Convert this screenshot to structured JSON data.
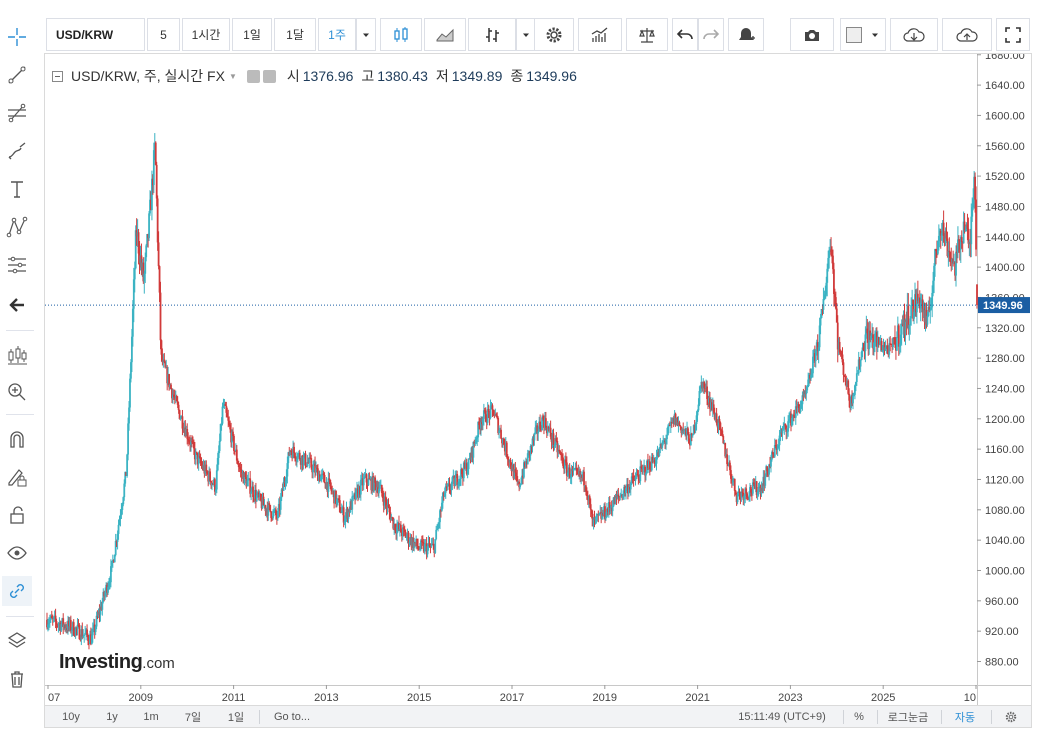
{
  "toolbar": {
    "symbol": "USD/KRW",
    "intervals": [
      "5",
      "1시간",
      "1일",
      "1달",
      "1주"
    ],
    "active_interval": "1주"
  },
  "legend": {
    "title": "USD/KRW, 주, 실시간 FX",
    "open_label": "시",
    "open": "1376.96",
    "high_label": "고",
    "high": "1380.43",
    "low_label": "저",
    "low": "1349.89",
    "close_label": "종",
    "close": "1349.96"
  },
  "watermark": {
    "brand": "Investing",
    "domain": ".com"
  },
  "bottom_bar": {
    "ranges": [
      "10y",
      "1y",
      "1m",
      "7일",
      "1일"
    ],
    "goto": "Go to...",
    "clock": "15:11:49 (UTC+9)",
    "percent": "%",
    "log_scale": "로그눈금",
    "auto": "자동"
  },
  "colors": {
    "up": "#3bb3c3",
    "down": "#d13a3a",
    "price_line": "#1b5ea3",
    "price_tag_bg": "#1b5ea3",
    "accent": "#2d8fd5"
  },
  "icons": [
    "crosshair-icon",
    "trend-line-icon",
    "fib-icon",
    "brush-icon",
    "text-icon",
    "pattern-icon",
    "measure-icon",
    "back-arrow-icon",
    "zoom-icon",
    "magnet-icon",
    "lock-pencil-icon",
    "lock-icon",
    "eye-icon",
    "link-icon",
    "layers-icon",
    "trash-icon",
    "candles-icon",
    "area-icon",
    "bars-icon",
    "gear-icon",
    "indicators-icon",
    "scale-icon",
    "undo-icon",
    "redo-icon",
    "alert-icon",
    "camera-icon",
    "cloud-download-icon",
    "cloud-upload-icon",
    "fullscreen-icon"
  ],
  "chart_data": {
    "type": "candlestick",
    "symbol": "USD/KRW",
    "timeframe": "weekly",
    "title": "USD/KRW, 주, 실시간 FX",
    "x_ticks": [
      "07",
      "2009",
      "2011",
      "2013",
      "2015",
      "2017",
      "2019",
      "2021",
      "2023",
      "2025",
      "10"
    ],
    "x_range": [
      2007.0,
      2025.75
    ],
    "y_range": [
      849,
      1681
    ],
    "y_ticks": [
      "1680.00",
      "1640.00",
      "1600.00",
      "1560.00",
      "1520.00",
      "1480.00",
      "1440.00",
      "1400.00",
      "1360.00",
      "1320.00",
      "1280.00",
      "1240.00",
      "1200.00",
      "1160.00",
      "1120.00",
      "1080.00",
      "1040.00",
      "1000.00",
      "960.00",
      "920.00",
      "880.00"
    ],
    "last_price": "1349.96",
    "grid": false,
    "series": [
      {
        "name": "USD/KRW",
        "x": [
          2007.0,
          2007.5,
          2007.9,
          2008.3,
          2008.6,
          2008.8,
          2008.95,
          2009.05,
          2009.18,
          2009.3,
          2009.6,
          2010.0,
          2010.4,
          2010.55,
          2010.9,
          2011.3,
          2011.65,
          2011.9,
          2012.3,
          2012.7,
          2013.0,
          2013.4,
          2013.7,
          2014.0,
          2014.5,
          2014.8,
          2015.0,
          2015.5,
          2015.75,
          2016.0,
          2016.3,
          2016.5,
          2016.85,
          2017.0,
          2017.5,
          2017.85,
          2018.0,
          2018.3,
          2018.7,
          2019.0,
          2019.3,
          2019.65,
          2020.0,
          2020.2,
          2020.5,
          2020.9,
          2021.4,
          2021.8,
          2022.3,
          2022.6,
          2022.8,
          2022.95,
          2023.2,
          2023.5,
          2023.75,
          2024.0,
          2024.4,
          2024.6,
          2024.75,
          2025.0,
          2025.3,
          2025.5,
          2025.6,
          2025.7,
          2025.75
        ],
        "close": [
          935,
          925,
          910,
          1000,
          1130,
          1450,
          1380,
          1450,
          1560,
          1280,
          1220,
          1150,
          1110,
          1220,
          1130,
          1090,
          1070,
          1160,
          1140,
          1110,
          1070,
          1120,
          1110,
          1060,
          1030,
          1030,
          1100,
          1140,
          1200,
          1210,
          1150,
          1110,
          1180,
          1200,
          1130,
          1120,
          1060,
          1080,
          1110,
          1130,
          1150,
          1200,
          1170,
          1250,
          1200,
          1100,
          1110,
          1180,
          1230,
          1320,
          1440,
          1300,
          1220,
          1310,
          1300,
          1290,
          1340,
          1360,
          1320,
          1460,
          1400,
          1460,
          1420,
          1540,
          1350
        ]
      }
    ]
  }
}
